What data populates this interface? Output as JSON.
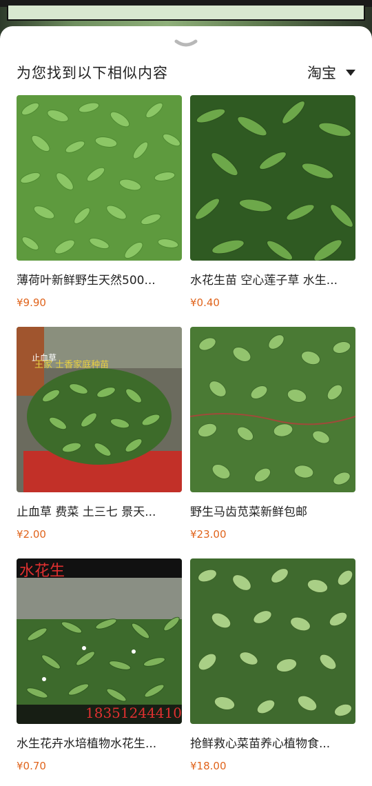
{
  "header": {
    "title": "为您找到以下相似内容",
    "source_label": "淘宝"
  },
  "colors": {
    "price": "#e0641c",
    "text": "#222222",
    "sheet_bg": "#ffffff"
  },
  "items": [
    {
      "title": "薄荷叶新鲜野生天然500...",
      "price": "¥9.90",
      "image": "plant-dense-light"
    },
    {
      "title": "水花生苗 空心莲子草 水生...",
      "price": "¥0.40",
      "image": "plant-dark-leaves"
    },
    {
      "title": "止血草  费菜  土三七 景天...",
      "price": "¥2.00",
      "image": "plant-in-pot",
      "image_text": [
        "止血草",
        "王家 士香家庭种苗"
      ]
    },
    {
      "title": "野生马齿苋菜新鲜包邮",
      "price": "¥23.00",
      "image": "plant-succulent"
    },
    {
      "title": "水生花卉水培植物水花生...",
      "price": "¥0.70",
      "image": "plant-flowering",
      "image_text": [
        "水花生",
        "18351244410"
      ]
    },
    {
      "title": "抢鲜救心菜苗养心植物食...",
      "price": "¥18.00",
      "image": "plant-succulent-pale"
    }
  ]
}
